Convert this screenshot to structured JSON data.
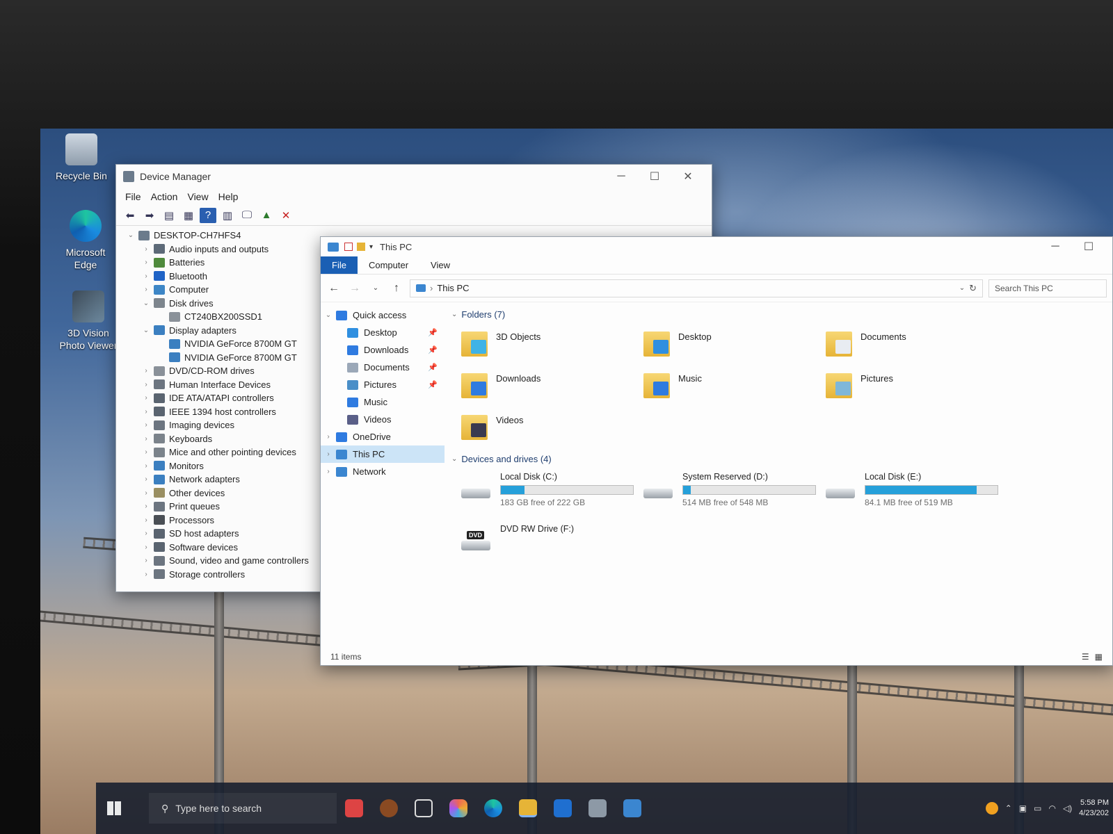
{
  "desktop_icons": [
    {
      "label": "Recycle Bin"
    },
    {
      "label": "Microsoft Edge"
    },
    {
      "label": "3D Vision Photo Viewer"
    }
  ],
  "device_manager": {
    "title": "Device Manager",
    "menu": [
      "File",
      "Action",
      "View",
      "Help"
    ],
    "tree": [
      {
        "label": "DESKTOP-CH7HFS4",
        "level": 0,
        "toggle": "v",
        "icon_color": "#6b7b8c"
      },
      {
        "label": "Audio inputs and outputs",
        "level": 1,
        "toggle": ">",
        "icon_color": "#5d6a78"
      },
      {
        "label": "Batteries",
        "level": 1,
        "toggle": ">",
        "icon_color": "#4f8a3c"
      },
      {
        "label": "Bluetooth",
        "level": 1,
        "toggle": ">",
        "icon_color": "#1f63c6"
      },
      {
        "label": "Computer",
        "level": 1,
        "toggle": ">",
        "icon_color": "#3d86c6"
      },
      {
        "label": "Disk drives",
        "level": 1,
        "toggle": "v",
        "icon_color": "#7d858d"
      },
      {
        "label": "CT240BX200SSD1",
        "level": 2,
        "toggle": "",
        "icon_color": "#8a9199"
      },
      {
        "label": "Display adapters",
        "level": 1,
        "toggle": "v",
        "icon_color": "#3b7fc0"
      },
      {
        "label": "NVIDIA GeForce 8700M GT",
        "level": 2,
        "toggle": "",
        "icon_color": "#3b7fc0"
      },
      {
        "label": "NVIDIA GeForce 8700M GT",
        "level": 2,
        "toggle": "",
        "icon_color": "#3b7fc0"
      },
      {
        "label": "DVD/CD-ROM drives",
        "level": 1,
        "toggle": ">",
        "icon_color": "#8a9199"
      },
      {
        "label": "Human Interface Devices",
        "level": 1,
        "toggle": ">",
        "icon_color": "#6c7580"
      },
      {
        "label": "IDE ATA/ATAPI controllers",
        "level": 1,
        "toggle": ">",
        "icon_color": "#5a6470"
      },
      {
        "label": "IEEE 1394 host controllers",
        "level": 1,
        "toggle": ">",
        "icon_color": "#5a6470"
      },
      {
        "label": "Imaging devices",
        "level": 1,
        "toggle": ">",
        "icon_color": "#6c7580"
      },
      {
        "label": "Keyboards",
        "level": 1,
        "toggle": ">",
        "icon_color": "#7b838b"
      },
      {
        "label": "Mice and other pointing devices",
        "level": 1,
        "toggle": ">",
        "icon_color": "#7b838b"
      },
      {
        "label": "Monitors",
        "level": 1,
        "toggle": ">",
        "icon_color": "#3b7fc0"
      },
      {
        "label": "Network adapters",
        "level": 1,
        "toggle": ">",
        "icon_color": "#3b7fc0"
      },
      {
        "label": "Other devices",
        "level": 1,
        "toggle": ">",
        "icon_color": "#9a8f62"
      },
      {
        "label": "Print queues",
        "level": 1,
        "toggle": ">",
        "icon_color": "#6c7580"
      },
      {
        "label": "Processors",
        "level": 1,
        "toggle": ">",
        "icon_color": "#4a4f55"
      },
      {
        "label": "SD host adapters",
        "level": 1,
        "toggle": ">",
        "icon_color": "#5a6470"
      },
      {
        "label": "Software devices",
        "level": 1,
        "toggle": ">",
        "icon_color": "#5a6470"
      },
      {
        "label": "Sound, video and game controllers",
        "level": 1,
        "toggle": ">",
        "icon_color": "#6c7580"
      },
      {
        "label": "Storage controllers",
        "level": 1,
        "toggle": ">",
        "icon_color": "#6c7580"
      }
    ]
  },
  "explorer": {
    "title": "This PC",
    "ribbon_tabs": [
      "File",
      "Computer",
      "View"
    ],
    "address": "This PC",
    "search_placeholder": "Search This PC",
    "nav": [
      {
        "label": "Quick access",
        "chevron": "v",
        "indent": 0,
        "icon_color": "#2f7be0",
        "pinned": false
      },
      {
        "label": "Desktop",
        "chevron": "",
        "indent": 1,
        "icon_color": "#2f8fe0",
        "pinned": true
      },
      {
        "label": "Downloads",
        "chevron": "",
        "indent": 1,
        "icon_color": "#2f7be0",
        "pinned": true
      },
      {
        "label": "Documents",
        "chevron": "",
        "indent": 1,
        "icon_color": "#9ba8b8",
        "pinned": true
      },
      {
        "label": "Pictures",
        "chevron": "",
        "indent": 1,
        "icon_color": "#4a8fc8",
        "pinned": true
      },
      {
        "label": "Music",
        "chevron": "",
        "indent": 1,
        "icon_color": "#2f7be0",
        "pinned": false
      },
      {
        "label": "Videos",
        "chevron": "",
        "indent": 1,
        "icon_color": "#5a5f88",
        "pinned": false
      },
      {
        "label": "OneDrive",
        "chevron": ">",
        "indent": 0,
        "icon_color": "#2f7be0",
        "pinned": false
      },
      {
        "label": "This PC",
        "chevron": ">",
        "indent": 0,
        "icon_color": "#3b86d0",
        "pinned": false,
        "selected": true
      },
      {
        "label": "Network",
        "chevron": ">",
        "indent": 0,
        "icon_color": "#3b86d0",
        "pinned": false
      }
    ],
    "folders_header": "Folders (7)",
    "folders": [
      {
        "label": "3D Objects",
        "overlay": "#3fb3e6"
      },
      {
        "label": "Desktop",
        "overlay": "#2f8fe0"
      },
      {
        "label": "Documents",
        "overlay": "#e8ecf2"
      },
      {
        "label": "Downloads",
        "overlay": "#2f7be0"
      },
      {
        "label": "Music",
        "overlay": "#2f7be0"
      },
      {
        "label": "Pictures",
        "overlay": "#7fb7d9"
      },
      {
        "label": "Videos",
        "overlay": "#3a3a50"
      }
    ],
    "drives_header": "Devices and drives (4)",
    "drives": [
      {
        "label": "Local Disk (C:)",
        "free": "183 GB free of 222 GB",
        "used_fraction": 0.18,
        "has_bar": true
      },
      {
        "label": "System Reserved (D:)",
        "free": "514 MB free of 548 MB",
        "used_fraction": 0.06,
        "has_bar": true
      },
      {
        "label": "Local Disk (E:)",
        "free": "84.1 MB free of 519 MB",
        "used_fraction": 0.84,
        "has_bar": true
      },
      {
        "label": "DVD RW Drive (F:)",
        "free": "",
        "used_fraction": 0,
        "has_bar": false,
        "badge": "DVD"
      }
    ],
    "status": "11 items"
  },
  "taskbar": {
    "search_placeholder": "Type here to search",
    "time": "5:58 PM",
    "date": "4/23/202"
  },
  "colors": {
    "accent": "#1a5fb4",
    "drive_fill": "#26a0da"
  }
}
